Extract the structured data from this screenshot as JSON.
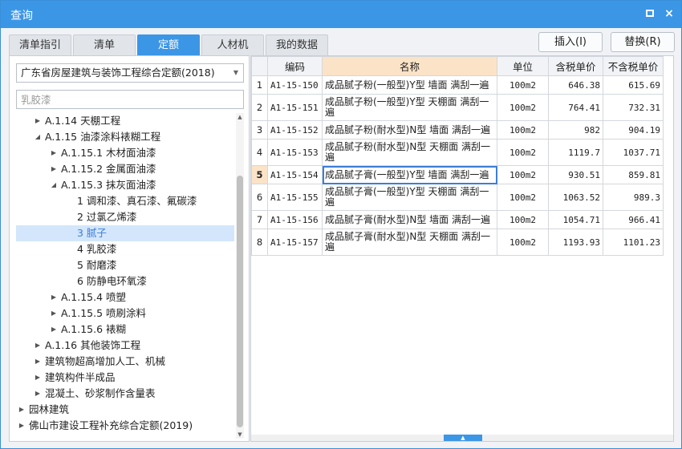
{
  "window": {
    "title": "查询",
    "maximize_label": "□",
    "close_label": "×"
  },
  "tabs": [
    "清单指引",
    "清单",
    "定额",
    "人材机",
    "我的数据"
  ],
  "active_tab": "定额",
  "actions": {
    "insert_label": "插入(I)",
    "replace_label": "替换(R)"
  },
  "left": {
    "quota_select": "广东省房屋建筑与装饰工程综合定额(2018)",
    "search": {
      "value": "",
      "placeholder": "乳胶漆"
    },
    "tree": [
      {
        "label": "A.1.14 天棚工程",
        "level": 1,
        "expander": "collapsed"
      },
      {
        "label": "A.1.15 油漆涂料裱糊工程",
        "level": 1,
        "expander": "expanded"
      },
      {
        "label": "A.1.15.1 木材面油漆",
        "level": 2,
        "expander": "collapsed"
      },
      {
        "label": "A.1.15.2 金属面油漆",
        "level": 2,
        "expander": "collapsed"
      },
      {
        "label": "A.1.15.3 抹灰面油漆",
        "level": 2,
        "expander": "expanded"
      },
      {
        "label": "1 调和漆、真石漆、氟碳漆",
        "level": 3,
        "expander": "none"
      },
      {
        "label": "2 过氯乙烯漆",
        "level": 3,
        "expander": "none"
      },
      {
        "label": "3 腻子",
        "level": 3,
        "expander": "none",
        "selected": true
      },
      {
        "label": "4 乳胶漆",
        "level": 3,
        "expander": "none"
      },
      {
        "label": "5 耐磨漆",
        "level": 3,
        "expander": "none"
      },
      {
        "label": "6 防静电环氧漆",
        "level": 3,
        "expander": "none"
      },
      {
        "label": "A.1.15.4 喷塑",
        "level": 2,
        "expander": "collapsed"
      },
      {
        "label": "A.1.15.5 喷刷涂料",
        "level": 2,
        "expander": "collapsed"
      },
      {
        "label": "A.1.15.6 裱糊",
        "level": 2,
        "expander": "collapsed"
      },
      {
        "label": "A.1.16 其他装饰工程",
        "level": 1,
        "expander": "collapsed"
      },
      {
        "label": "建筑物超高增加人工、机械",
        "level": 1,
        "expander": "collapsed"
      },
      {
        "label": "建筑构件半成品",
        "level": 1,
        "expander": "collapsed"
      },
      {
        "label": "混凝土、砂浆制作含量表",
        "level": 1,
        "expander": "collapsed"
      },
      {
        "label": "园林建筑",
        "level": 0,
        "expander": "collapsed"
      },
      {
        "label": "佛山市建设工程补充综合定额(2019)",
        "level": 0,
        "expander": "collapsed"
      }
    ]
  },
  "grid": {
    "columns": [
      "",
      "编码",
      "名称",
      "单位",
      "含税单价",
      "不含税单价"
    ],
    "current_row": 5,
    "rows": [
      {
        "idx": "1",
        "code": "A1-15-150",
        "name": "成品腻子粉(一般型)Y型 墙面 满刮一遍",
        "unit": "100m2",
        "price_tax": "646.38",
        "price_notax": "615.69"
      },
      {
        "idx": "2",
        "code": "A1-15-151",
        "name": "成品腻子粉(一般型)Y型 天棚面 满刮一遍",
        "unit": "100m2",
        "price_tax": "764.41",
        "price_notax": "732.31"
      },
      {
        "idx": "3",
        "code": "A1-15-152",
        "name": "成品腻子粉(耐水型)N型 墙面 满刮一遍",
        "unit": "100m2",
        "price_tax": "982",
        "price_notax": "904.19"
      },
      {
        "idx": "4",
        "code": "A1-15-153",
        "name": "成品腻子粉(耐水型)N型 天棚面 满刮一遍",
        "unit": "100m2",
        "price_tax": "1119.7",
        "price_notax": "1037.71"
      },
      {
        "idx": "5",
        "code": "A1-15-154",
        "name": "成品腻子膏(一般型)Y型 墙面 满刮一遍",
        "unit": "100m2",
        "price_tax": "930.51",
        "price_notax": "859.81"
      },
      {
        "idx": "6",
        "code": "A1-15-155",
        "name": "成品腻子膏(一般型)Y型 天棚面 满刮一遍",
        "unit": "100m2",
        "price_tax": "1063.52",
        "price_notax": "989.3"
      },
      {
        "idx": "7",
        "code": "A1-15-156",
        "name": "成品腻子膏(耐水型)N型 墙面 满刮一遍",
        "unit": "100m2",
        "price_tax": "1054.71",
        "price_notax": "966.41"
      },
      {
        "idx": "8",
        "code": "A1-15-157",
        "name": "成品腻子膏(耐水型)N型 天棚面 满刮一遍",
        "unit": "100m2",
        "price_tax": "1193.93",
        "price_notax": "1101.23"
      }
    ]
  },
  "colors": {
    "accent": "#3c96e6",
    "header_highlight": "#fbe3c7",
    "selection": "#d3e6fb"
  }
}
